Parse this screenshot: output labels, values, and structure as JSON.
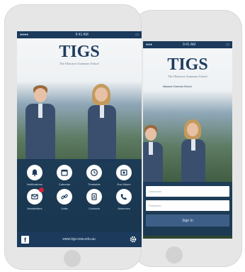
{
  "back_phone": {
    "status_time": "9:41 AM",
    "logo": "TIGS",
    "logo_subtitle": "The Illawarra Grammar School",
    "crest_caption": "Illawarra Grammar School",
    "login": {
      "username_placeholder": "Username",
      "password_placeholder": "Password",
      "signin_label": "Sign In"
    }
  },
  "front_phone": {
    "status_time": "9:41 AM",
    "logo": "TIGS",
    "logo_subtitle": "The Illawarra Grammar School",
    "tiles": [
      {
        "label": "Notifications",
        "icon": "bell-icon",
        "badge": false
      },
      {
        "label": "Calendar",
        "icon": "calendar-icon",
        "badge": false
      },
      {
        "label": "Timetable",
        "icon": "clock-icon",
        "badge": false
      },
      {
        "label": "Eve Album",
        "icon": "album-icon",
        "badge": false
      },
      {
        "label": "Newsletters",
        "icon": "mail-icon",
        "badge": true
      },
      {
        "label": "Links",
        "icon": "link-icon",
        "badge": false
      },
      {
        "label": "Contacts",
        "icon": "contacts-icon",
        "badge": false
      },
      {
        "label": "Absences",
        "icon": "phone-icon",
        "badge": false
      }
    ],
    "footer": {
      "url": "www.tigs.nsw.edu.au"
    }
  },
  "colors": {
    "navy": "#1b3a5c",
    "panel": "#163456",
    "badge": "#d0233a"
  }
}
